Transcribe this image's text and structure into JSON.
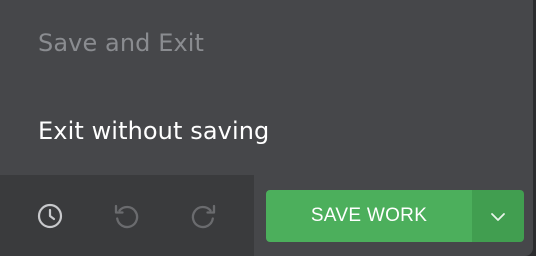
{
  "menu": {
    "items": [
      {
        "label": "Save and Exit",
        "state": "disabled"
      },
      {
        "label": "Exit without saving",
        "state": "enabled"
      }
    ]
  },
  "history": {
    "buttons": [
      {
        "icon": "clock-icon",
        "state": "enabled"
      },
      {
        "icon": "undo-icon",
        "state": "disabled"
      },
      {
        "icon": "redo-icon",
        "state": "disabled"
      }
    ]
  },
  "save": {
    "label": "SAVE WORK",
    "dropdown_icon": "chevron-down-icon",
    "color": "#4caf5c"
  }
}
